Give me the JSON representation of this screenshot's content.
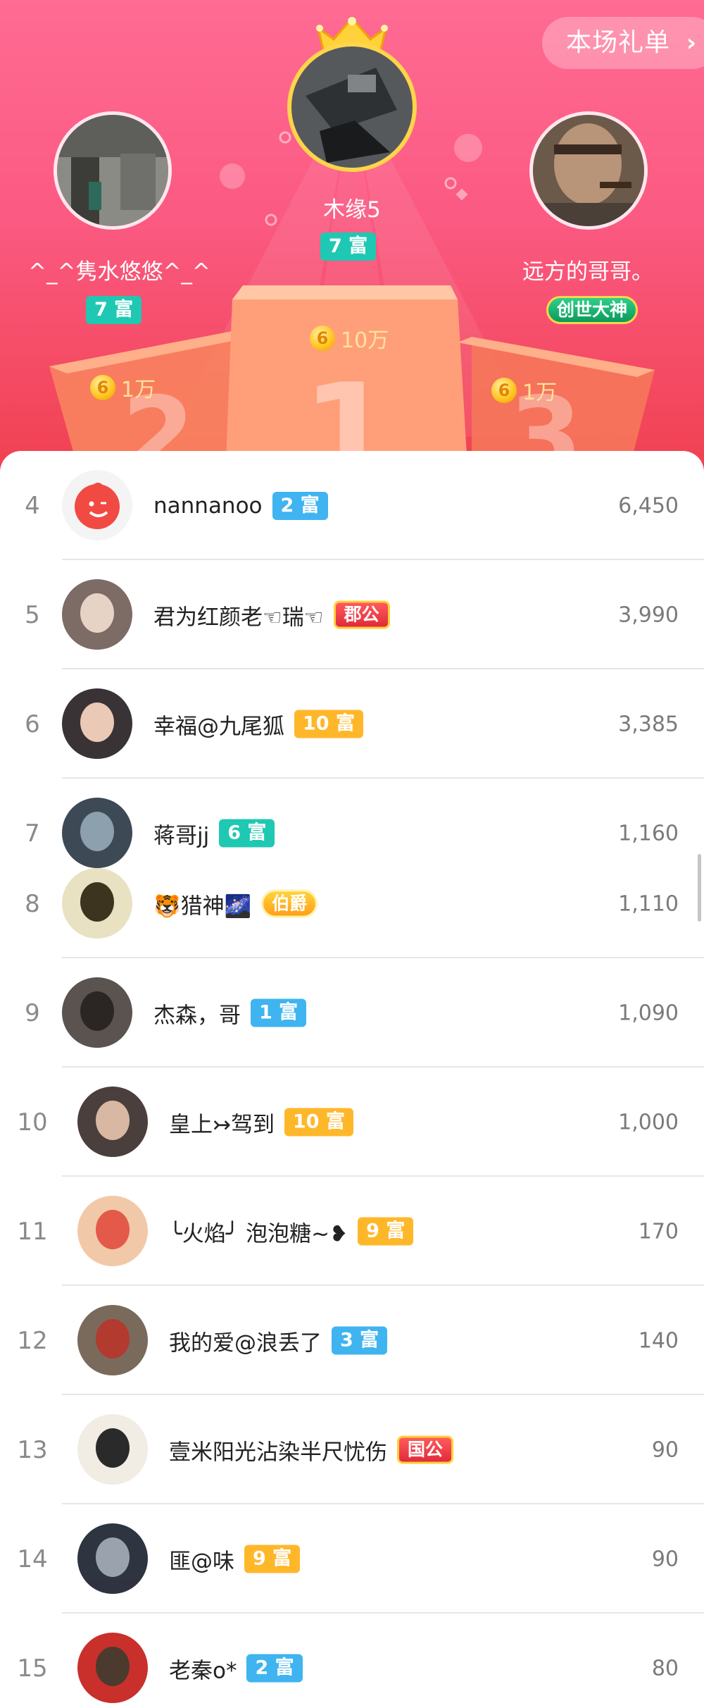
{
  "header": {
    "gift_list_label": "本场礼单"
  },
  "podium": {
    "first": {
      "name": "木缘5",
      "badge": "7 富",
      "amount": "10万",
      "rank_digit": "1"
    },
    "second": {
      "name": "^_^隽水悠悠^_^",
      "badge": "7 富",
      "amount": "1万",
      "rank_digit": "2"
    },
    "third": {
      "name": "远方的哥哥。",
      "badge": "创世大神",
      "amount": "1万",
      "rank_digit": "3"
    },
    "coin_symbol": "6"
  },
  "leaderboard": [
    {
      "rank": "4",
      "name": "nannanoo",
      "badge": "2 富",
      "badge_style": "blue",
      "score": "6,450"
    },
    {
      "rank": "5",
      "name": "君为红颜老☜瑞☜",
      "badge": "郡公",
      "badge_style": "red",
      "score": "3,990"
    },
    {
      "rank": "6",
      "name": "幸福@九尾狐",
      "badge": "10 富",
      "badge_style": "orange",
      "score": "3,385"
    },
    {
      "rank": "7",
      "name": "蒋哥jj",
      "badge": "6 富",
      "badge_style": "teal",
      "score": "1,160"
    },
    {
      "rank": "8",
      "name": "🐯猎神🌌",
      "badge": "伯爵",
      "badge_style": "gold",
      "score": "1,110"
    },
    {
      "rank": "9",
      "name": "杰森，哥",
      "badge": "1 富",
      "badge_style": "blue",
      "score": "1,090"
    },
    {
      "rank": "10",
      "name": "皇上↣驾到",
      "badge": "10 富",
      "badge_style": "orange",
      "score": "1,000"
    },
    {
      "rank": "11",
      "name": "╰火焰╯ 泡泡糖~❥",
      "badge": "9 富",
      "badge_style": "orange",
      "score": "170"
    },
    {
      "rank": "12",
      "name": "我的爱@浪丢了",
      "badge": "3 富",
      "badge_style": "blue",
      "score": "140"
    },
    {
      "rank": "13",
      "name": "壹米阳光沾染半尺忧伤",
      "badge": "国公",
      "badge_style": "red",
      "score": "90"
    },
    {
      "rank": "14",
      "name": "匪@味",
      "badge": "9 富",
      "badge_style": "orange",
      "score": "90"
    },
    {
      "rank": "15",
      "name": "老秦o*",
      "badge": "2 富",
      "badge_style": "blue",
      "score": "80"
    }
  ],
  "colors": {
    "hero_top": "#ff6b93",
    "hero_bottom": "#f0404f",
    "badge_teal": "#1fc8b2",
    "badge_blue": "#3fb4f0",
    "badge_orange": "#ffb72a",
    "coin_gold": "#ffc21a"
  }
}
